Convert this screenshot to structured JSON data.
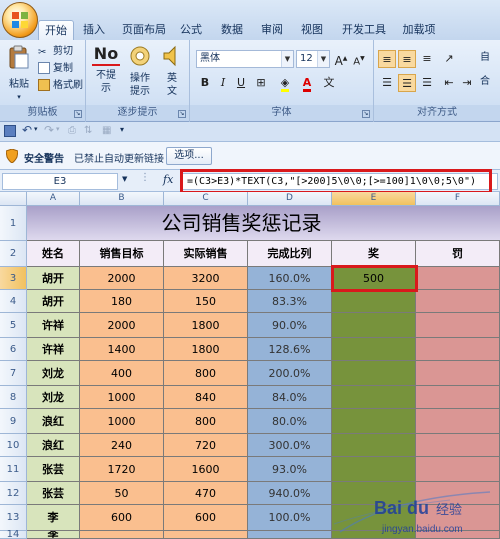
{
  "ribbon_tabs": [
    "开始",
    "插入",
    "页面布局",
    "公式",
    "数据",
    "审阅",
    "视图",
    "开发工具",
    "加载项"
  ],
  "clipboard": {
    "paste": "粘贴",
    "cut": "剪切",
    "copy": "复制",
    "format_painter": "格式刷",
    "label": "剪贴板"
  },
  "steps": {
    "no_prompt_1": "不提",
    "no_prompt_2": "示",
    "operate_1": "操作",
    "operate_2": "提示",
    "english_1": "英",
    "english_2": "文",
    "label": "逐步提示"
  },
  "font": {
    "name": "黑体",
    "size": "12",
    "label": "字体",
    "bold": "B",
    "italic": "I",
    "underline": "U"
  },
  "alignment": {
    "label": "对齐方式",
    "wrap": "自",
    "merge": "合"
  },
  "security": {
    "title": "安全警告",
    "message": "已禁止自动更新链接",
    "options_button": "选项..."
  },
  "formula_bar": {
    "name_box": "E3",
    "fx": "fx",
    "formula": "=(C3>E3)*TEXT(C3,\"[>200]5\\0\\0;[>=100]1\\0\\0;5\\0\")"
  },
  "columns": [
    "A",
    "B",
    "C",
    "D",
    "E",
    "F"
  ],
  "selected_column": "E",
  "selected_row": "3",
  "row_numbers": [
    "1",
    "2",
    "3",
    "4",
    "5",
    "6",
    "7",
    "8",
    "9",
    "10",
    "11",
    "12",
    "13",
    "14"
  ],
  "sheet": {
    "title": "公司销售奖惩记录",
    "headers": [
      "姓名",
      "销售目标",
      "实际销售",
      "完成比列",
      "奖",
      "罚"
    ],
    "rows": [
      [
        "胡开",
        "2000",
        "3200",
        "160.0%",
        "500",
        ""
      ],
      [
        "胡开",
        "180",
        "150",
        "83.3%",
        "",
        ""
      ],
      [
        "许祥",
        "2000",
        "1800",
        "90.0%",
        "",
        ""
      ],
      [
        "许祥",
        "1400",
        "1800",
        "128.6%",
        "",
        ""
      ],
      [
        "刘龙",
        "400",
        "800",
        "200.0%",
        "",
        ""
      ],
      [
        "刘龙",
        "1000",
        "840",
        "84.0%",
        "",
        ""
      ],
      [
        "浪红",
        "1000",
        "800",
        "80.0%",
        "",
        ""
      ],
      [
        "浪红",
        "240",
        "720",
        "300.0%",
        "",
        ""
      ],
      [
        "张芸",
        "1720",
        "1600",
        "93.0%",
        "",
        ""
      ],
      [
        "张芸",
        "50",
        "470",
        "940.0%",
        "",
        ""
      ],
      [
        "李",
        "600",
        "600",
        "100.0%",
        "",
        ""
      ],
      [
        "李",
        "",
        "",
        "",
        "",
        ""
      ]
    ]
  },
  "colors": {
    "name_col": "#d8e4bc",
    "target_col": "#fabf8f",
    "pct_col": "#95b3d7",
    "reward_col": "#77933c",
    "penalty_col": "#da9694",
    "highlight": "#d9191c"
  },
  "watermark": {
    "brand": "Bai du",
    "line2": "经验",
    "url": "jingyan.baidu.com"
  }
}
